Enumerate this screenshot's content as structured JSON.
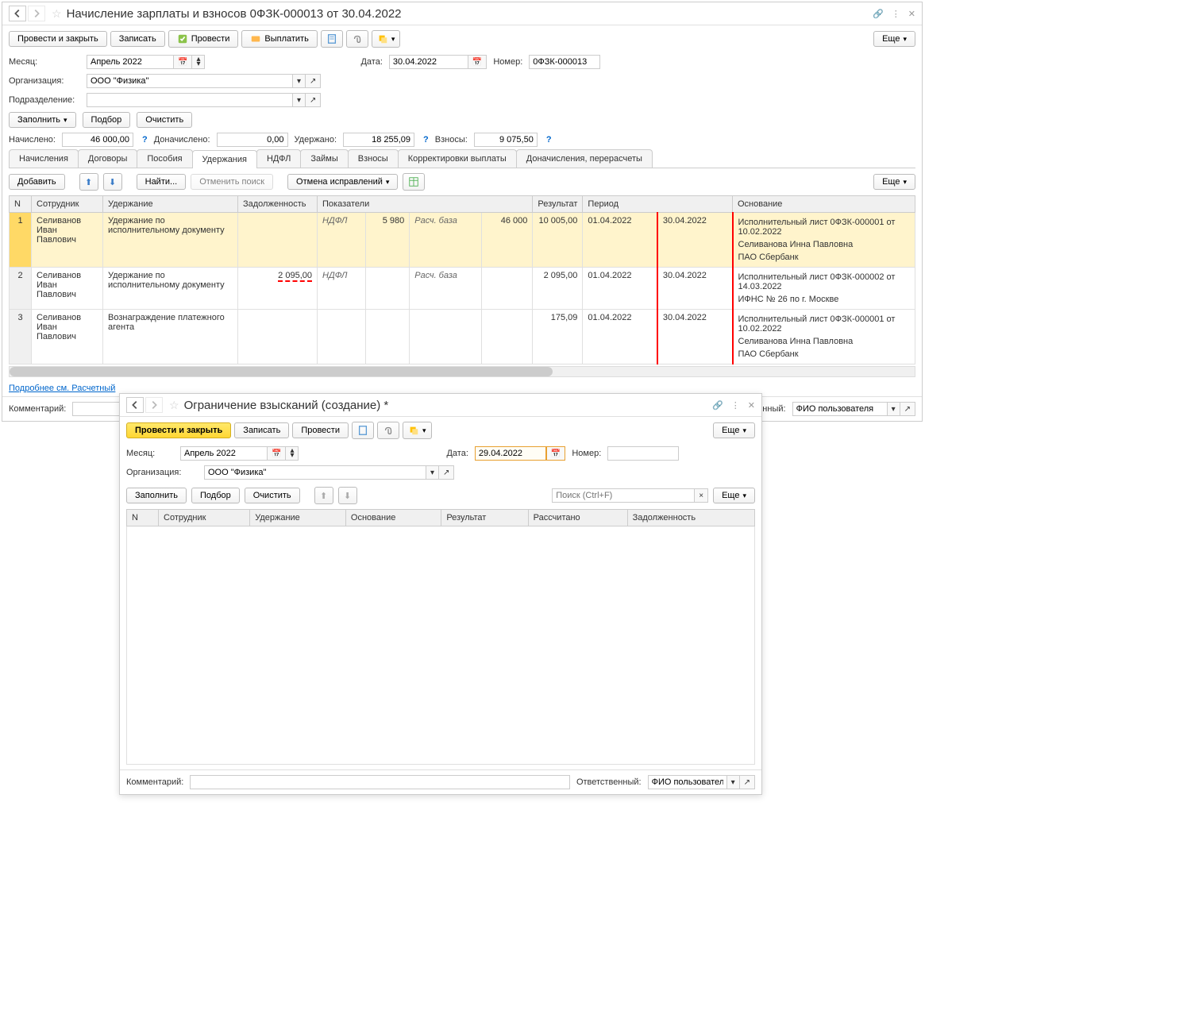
{
  "main": {
    "title": "Начисление зарплаты и взносов 0ФЗК-000013 от 30.04.2022",
    "toolbar": {
      "post_close": "Провести и закрыть",
      "save": "Записать",
      "post": "Провести",
      "pay": "Выплатить",
      "more": "Еще"
    },
    "labels": {
      "month": "Месяц:",
      "date": "Дата:",
      "number": "Номер:",
      "org": "Организация:",
      "dept": "Подразделение:",
      "fill": "Заполнить",
      "select": "Подбор",
      "clear": "Очистить",
      "accrued": "Начислено:",
      "addl": "Доначислено:",
      "withheld": "Удержано:",
      "contrib": "Взносы:",
      "comment": "Комментарий:",
      "responsible": "Ответственный:",
      "details_link": "Подробнее см. Расчетный"
    },
    "fields": {
      "month": "Апрель 2022",
      "date": "30.04.2022",
      "number": "0ФЗК-000013",
      "org": "ООО \"Физика\"",
      "dept": "",
      "accrued": "46 000,00",
      "addl": "0,00",
      "withheld": "18 255,09",
      "contrib": "9 075,50",
      "responsible": "ФИО пользователя"
    },
    "tabs": [
      "Начисления",
      "Договоры",
      "Пособия",
      "Удержания",
      "НДФЛ",
      "Займы",
      "Взносы",
      "Корректировки выплаты",
      "Доначисления, перерасчеты"
    ],
    "active_tab": 3,
    "subtoolbar": {
      "add": "Добавить",
      "find": "Найти...",
      "cancel_search": "Отменить поиск",
      "cancel_fix": "Отмена исправлений",
      "more": "Еще"
    },
    "table": {
      "headers": [
        "N",
        "Сотрудник",
        "Удержание",
        "Задолженность",
        "Показатели",
        "",
        "",
        "",
        "Результат",
        "Период",
        "",
        "Основание"
      ],
      "rows": [
        {
          "n": "1",
          "employee": "Селиванов Иван Павлович",
          "deduction": "Удержание по исполнительному документу",
          "debt": "",
          "ind1": "НДФЛ",
          "ind1v": "5 980",
          "ind2": "Расч. база",
          "ind2v": "46 000",
          "result": "10 005,00",
          "period1": "01.04.2022",
          "period2": "30.04.2022",
          "basis": [
            "Исполнительный лист 0ФЗК-000001 от 10.02.2022",
            "Селиванова Инна Павловна",
            "ПАО Сбербанк"
          ]
        },
        {
          "n": "2",
          "employee": "Селиванов Иван Павлович",
          "deduction": "Удержание по исполнительному документу",
          "debt": "2 095,00",
          "ind1": "НДФЛ",
          "ind1v": "",
          "ind2": "Расч. база",
          "ind2v": "",
          "result": "2 095,00",
          "period1": "01.04.2022",
          "period2": "30.04.2022",
          "basis": [
            "Исполнительный лист 0ФЗК-000002 от 14.03.2022",
            "ИФНС № 26 по г. Москве"
          ]
        },
        {
          "n": "3",
          "employee": "Селиванов Иван Павлович",
          "deduction": "Вознаграждение платежного агента",
          "debt": "",
          "ind1": "",
          "ind1v": "",
          "ind2": "",
          "ind2v": "",
          "result": "175,09",
          "period1": "01.04.2022",
          "period2": "30.04.2022",
          "basis": [
            "Исполнительный лист 0ФЗК-000001 от 10.02.2022",
            "Селиванова Инна Павловна",
            "ПАО Сбербанк"
          ]
        }
      ]
    }
  },
  "modal": {
    "title": "Ограничение взысканий (создание) *",
    "toolbar": {
      "post_close": "Провести и закрыть",
      "save": "Записать",
      "post": "Провести",
      "more": "Еще"
    },
    "labels": {
      "month": "Месяц:",
      "date": "Дата:",
      "number": "Номер:",
      "org": "Организация:",
      "fill": "Заполнить",
      "select": "Подбор",
      "clear": "Очистить",
      "search_ph": "Поиск (Ctrl+F)",
      "more2": "Еще",
      "comment": "Комментарий:",
      "responsible": "Ответственный:"
    },
    "fields": {
      "month": "Апрель 2022",
      "date": "29.04.2022",
      "number": "",
      "org": "ООО \"Физика\"",
      "responsible": "ФИО пользователя"
    },
    "table": {
      "headers": [
        "N",
        "Сотрудник",
        "Удержание",
        "Основание",
        "Результат",
        "Рассчитано",
        "Задолженность"
      ]
    }
  }
}
